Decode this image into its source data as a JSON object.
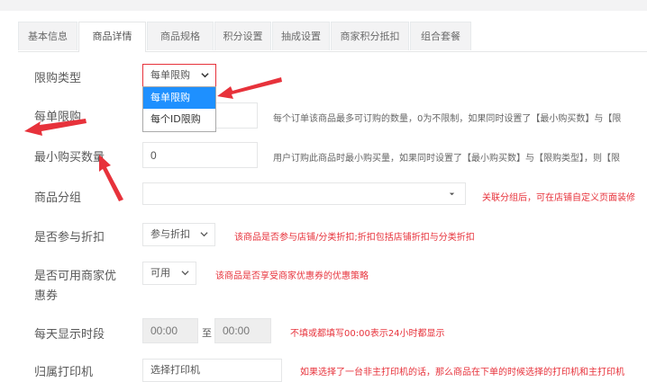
{
  "tabs": [
    {
      "label": "基本信息",
      "active": false
    },
    {
      "label": "商品详情",
      "active": true
    },
    {
      "label": "商品规格",
      "active": false
    },
    {
      "label": "积分设置",
      "active": false
    },
    {
      "label": "抽成设置",
      "active": false
    },
    {
      "label": "商家积分抵扣",
      "active": false
    },
    {
      "label": "组合套餐",
      "active": false
    }
  ],
  "form": {
    "limit_type": {
      "label": "限购类型",
      "value": "每单限购",
      "options": [
        "每单限购",
        "每个ID限购"
      ],
      "selected": "每单限购"
    },
    "per_order": {
      "label": "每单限购",
      "value": "",
      "help": "每个订单该商品最多可订购的数量，0为不限制，如果同时设置了【最小购买数】与【限"
    },
    "min_buy": {
      "label": "最小购买数量",
      "value": "0",
      "help": "用户订购此商品时最小购买量，如果同时设置了【最小购买数】与【限购类型】，则【限"
    },
    "category": {
      "label": "商品分组",
      "value": "",
      "warn": "关联分组后，可在店铺自定义页面装修"
    },
    "discount": {
      "label": "是否参与折扣",
      "value": "参与折扣",
      "warn": "该商品是否参与店铺/分类折扣;折扣包括店铺折扣与分类折扣"
    },
    "coupon": {
      "label_line1": "是否可用商家优",
      "label_line2": "惠券",
      "value": "可用",
      "warn": "该商品是否享受商家优惠券的优惠策略"
    },
    "time": {
      "label": "每天显示时段",
      "start": "00:00",
      "sep": "至",
      "end": "00:00",
      "warn": "不填或都填写00:00表示24小时都显示"
    },
    "printer": {
      "label": "归属打印机",
      "value": "选择打印机",
      "warn": "如果选择了一台非主打印机的话，那么商品在下单的时候选择的打印机和主打印机"
    }
  },
  "colors": {
    "accent": "#1e90ff",
    "warn": "#e7323b",
    "annotation_arrow": "#e7323b"
  }
}
